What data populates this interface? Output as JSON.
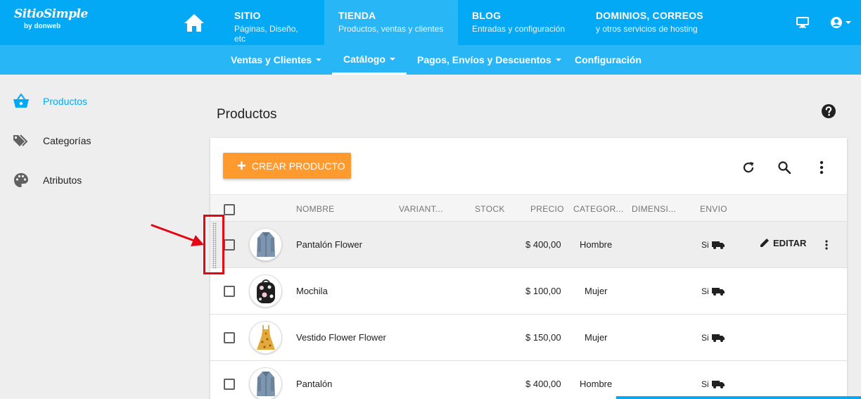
{
  "brand": {
    "name": "SitioSimple",
    "by": "by donweb"
  },
  "topnav": [
    {
      "title": "SITIO",
      "subtitle": "Páginas, Diseño, etc"
    },
    {
      "title": "TIENDA",
      "subtitle": "Productos, ventas y clientes"
    },
    {
      "title": "BLOG",
      "subtitle": "Entradas y configuración"
    },
    {
      "title": "DOMINIOS, CORREOS",
      "subtitle": "y otros servicios de hosting"
    }
  ],
  "subnav": [
    {
      "label": "Ventas y Clientes"
    },
    {
      "label": "Catálogo"
    },
    {
      "label": "Pagos, Envíos y Descuentos"
    },
    {
      "label": "Configuración"
    }
  ],
  "sidebar": [
    {
      "label": "Productos",
      "icon": "basket-icon"
    },
    {
      "label": "Categorías",
      "icon": "tags-icon"
    },
    {
      "label": "Atributos",
      "icon": "palette-icon"
    }
  ],
  "page": {
    "title": "Productos",
    "create_label": "CREAR PRODUCTO"
  },
  "table": {
    "headers": [
      "NOMBRE",
      "VARIANT...",
      "STOCK",
      "PRECIO",
      "CATEGOR...",
      "DIMENSI...",
      "ENVIO"
    ],
    "edit_label": "EDITAR",
    "rows": [
      {
        "name": "Pantalón Flower",
        "price": "$ 400,00",
        "category": "Hombre",
        "shipping": "Si"
      },
      {
        "name": "Mochila",
        "price": "$ 100,00",
        "category": "Mujer",
        "shipping": "Si"
      },
      {
        "name": "Vestido Flower Flower",
        "price": "$ 150,00",
        "category": "Mujer",
        "shipping": "Si"
      },
      {
        "name": "Pantalón",
        "price": "$ 400,00",
        "category": "Hombre",
        "shipping": "Si"
      }
    ]
  },
  "colors": {
    "primary": "#03a9f4",
    "secondary": "#29b6f6",
    "accent": "#ff9a2f",
    "highlight": "#e30613"
  }
}
